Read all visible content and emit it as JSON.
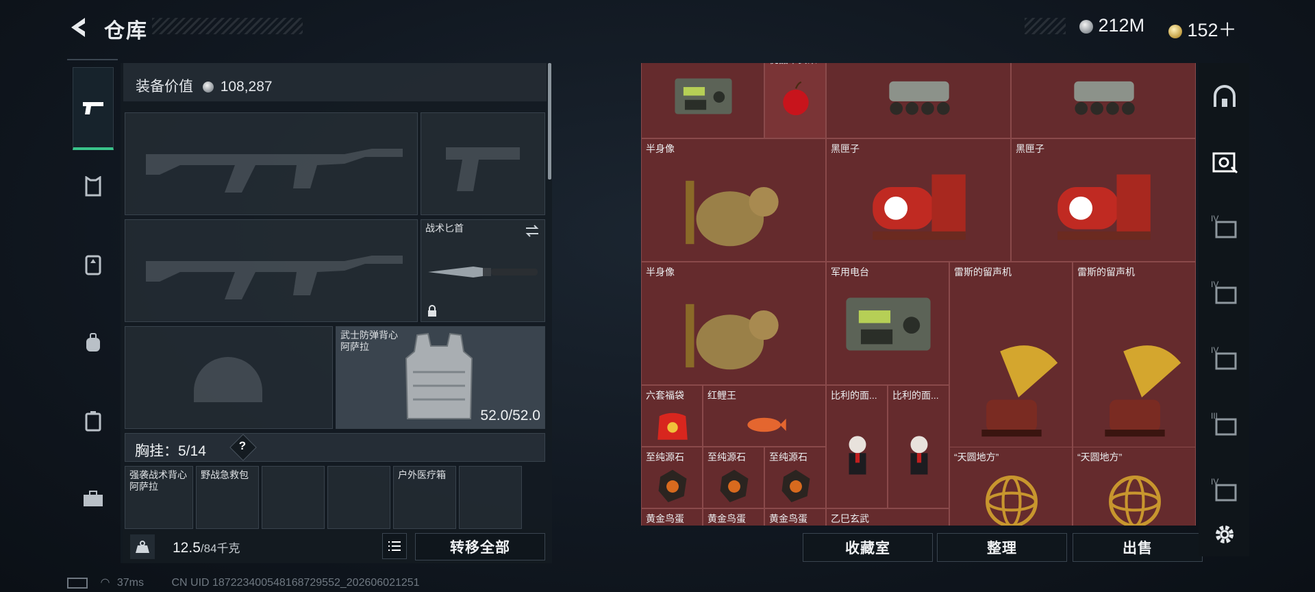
{
  "header": {
    "title": "仓库",
    "currency_silver": "212M",
    "currency_gold": "152＋"
  },
  "nav": {
    "items": [
      "weapon-icon",
      "armor-icon",
      "vest-icon",
      "backpack-icon",
      "case-icon",
      "toolbox-icon"
    ]
  },
  "equipment": {
    "value_label": "装备价值",
    "value": "108,287",
    "knife_label": "战术匕首",
    "armor_label": "武士防弹背心\n阿萨拉",
    "armor_durability": "52.0/52.0",
    "chest_label": "胸挂：5/14",
    "chest_help": "?",
    "chest_items": [
      "强袭战术背心\n阿萨拉",
      "野战急救包",
      "",
      "",
      "户外医疗箱",
      ""
    ],
    "weight_value": "12.5",
    "weight_max": "/84千克",
    "transfer_all": "转移全部"
  },
  "stash": {
    "items": [
      {
        "label": "",
        "icon": "radio"
      },
      {
        "label": "优品平安果",
        "icon": "apple"
      },
      {
        "label": "",
        "icon": "vehicle"
      },
      {
        "label": "",
        "icon": "vehicle"
      },
      {
        "label": "半身像",
        "icon": "bust"
      },
      {
        "label": "黑匣子",
        "icon": "blackbox"
      },
      {
        "label": "黑匣子",
        "icon": "blackbox"
      },
      {
        "label": "半身像",
        "icon": "bust"
      },
      {
        "label": "军用电台",
        "icon": "radio"
      },
      {
        "label": "雷斯的留声机",
        "icon": "phonograph"
      },
      {
        "label": "雷斯的留声机",
        "icon": "phonograph"
      },
      {
        "label": "六套福袋",
        "icon": "luckybag"
      },
      {
        "label": "红鲤王",
        "icon": "fish"
      },
      {
        "label": "比利的面...",
        "icon": "puppet"
      },
      {
        "label": "比利的面...",
        "icon": "puppet"
      },
      {
        "label": "至纯源石",
        "icon": "ore"
      },
      {
        "label": "至纯源石",
        "icon": "ore"
      },
      {
        "label": "至纯源石",
        "icon": "ore"
      },
      {
        "label": "“天圆地方”",
        "icon": "armillary"
      },
      {
        "label": "“天圆地方”",
        "icon": "armillary"
      },
      {
        "label": "黄金鸟蛋",
        "icon": "egg"
      },
      {
        "label": "黄金鸟蛋",
        "icon": "egg"
      },
      {
        "label": "黄金鸟蛋",
        "icon": "egg"
      },
      {
        "label": "乙巳玄武",
        "icon": "turtle"
      }
    ],
    "buttons": {
      "collection": "收藏室",
      "organize": "整理",
      "sell": "出售"
    },
    "tier_labels": [
      "IV",
      "IV",
      "IV",
      "III",
      "IV"
    ]
  },
  "footer": {
    "ping": "37ms",
    "uid": "CN UID 18722340054816872955​2_202606021251"
  },
  "colors": {
    "accent": "#39c38a",
    "stash_bg": "#652b2d"
  }
}
